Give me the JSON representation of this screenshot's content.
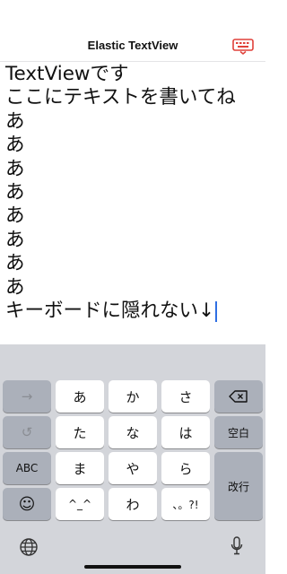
{
  "nav": {
    "title": "Elastic TextView"
  },
  "editor": {
    "lines": [
      "TextViewです",
      "ここにテキストを書いてね",
      "あ",
      "あ",
      "あ",
      "あ",
      "あ",
      "あ",
      "あ",
      "あ",
      "キーボードに隠れない↓"
    ]
  },
  "keyboard": {
    "keys": {
      "arrow": "→",
      "a": "あ",
      "ka": "か",
      "sa": "さ",
      "undo": "↺",
      "ta": "た",
      "na": "な",
      "ha": "は",
      "space": "空白",
      "abc": "ABC",
      "ma": "ま",
      "ya": "や",
      "ra": "ら",
      "enter": "改行",
      "emoji": "☺",
      "kaomoji": "^_^",
      "wa": "わ",
      "punct": "、。?!"
    }
  },
  "colors": {
    "caret": "#2f6fe3",
    "toggle_icon": "#e0413a",
    "keyboard_bg": "#d3d5da"
  }
}
